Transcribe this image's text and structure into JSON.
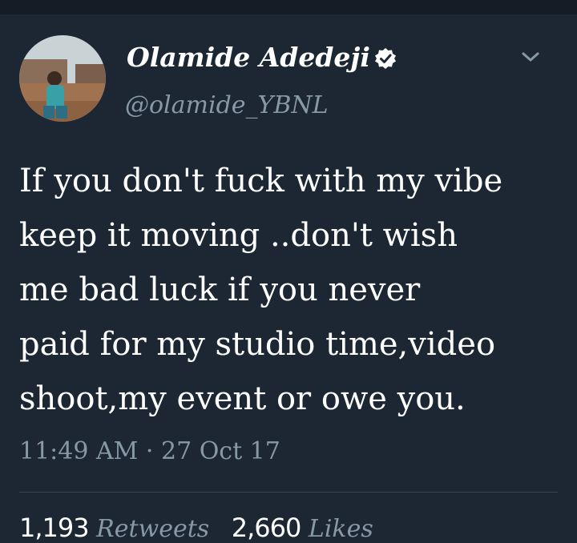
{
  "user": {
    "display_name": "Olamide Adedeji",
    "handle": "@olamide_YBNL",
    "verified": true
  },
  "tweet": {
    "lines": [
      "If you don't fuck with my vibe",
      "keep it moving ..don't wish",
      "me bad luck if you never",
      "paid for my studio time,video",
      "shoot,my event or owe you."
    ],
    "timestamp": "11:49 AM · 27 Oct 17"
  },
  "stats": {
    "retweets_count": "1,193",
    "retweets_label": "Retweets",
    "likes_count": "2,660",
    "likes_label": "Likes"
  },
  "colors": {
    "background": "#1c2733",
    "secondary_text": "#8899a6",
    "divider": "#38444d"
  },
  "icons": {
    "verified": "verified-badge-icon",
    "menu": "chevron-down-icon"
  }
}
